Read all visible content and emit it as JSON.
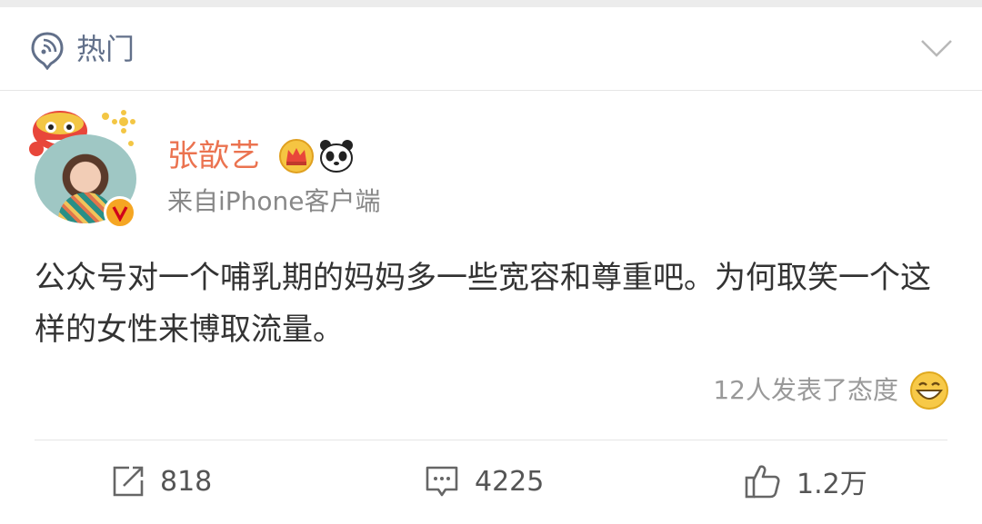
{
  "header": {
    "label": "热门"
  },
  "post": {
    "username": "张歆艺",
    "source": "来自iPhone客户端",
    "text": "公众号对一个哺乳期的妈妈多一些宽容和尊重吧。为何取笑一个这样的女性来博取流量。",
    "reactions": "12人发表了态度"
  },
  "actions": {
    "repost_count": "818",
    "comment_count": "4225",
    "like_count": "1.2万"
  },
  "icons": [
    "hot-icon",
    "chevron-down-icon",
    "crown-icon",
    "panda-icon",
    "verified-v-icon",
    "grin-emoji-icon",
    "repost-icon",
    "comment-icon",
    "thumbs-up-icon"
  ],
  "colors": {
    "username": "#eb7350",
    "header_label": "#62708a",
    "badge": "#f5a623"
  }
}
